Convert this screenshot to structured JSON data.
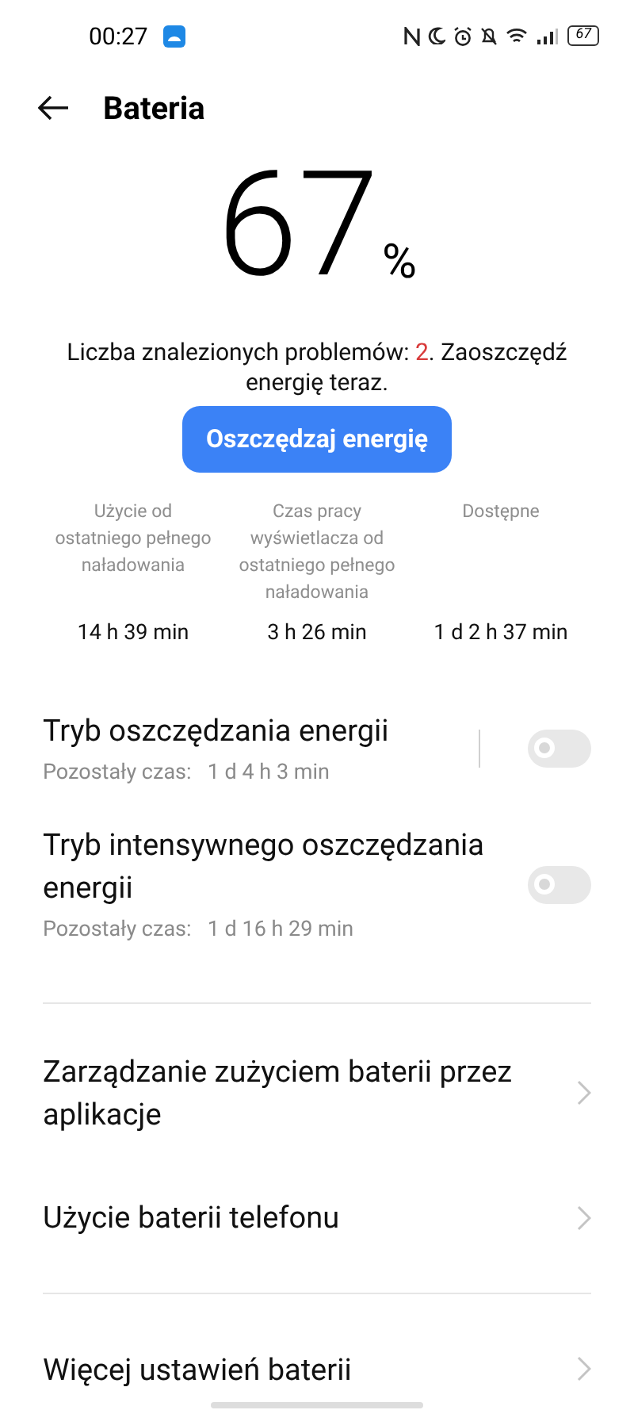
{
  "status_bar": {
    "time": "00:27",
    "battery": "67"
  },
  "header": {
    "title": "Bateria"
  },
  "level": {
    "value": "67",
    "unit": "%"
  },
  "problems": {
    "prefix": "Liczba znalezionych problemów: ",
    "count": "2",
    "suffix": ". Zaoszczędź energię teraz."
  },
  "action_button": "Oszczędzaj energię",
  "stats": [
    {
      "label": "Użycie od ostatniego pełnego naładowania",
      "value": "14 h 39 min"
    },
    {
      "label": "Czas pracy wyświetlacza od ostatniego pełnego naładowania",
      "value": "3 h 26 min"
    },
    {
      "label": "Dostępne",
      "value": "1 d 2 h 37 min"
    }
  ],
  "toggles": [
    {
      "title": "Tryb oszczędzania energii",
      "caption": "Pozostały czas:",
      "time": "1 d 4 h 3 min",
      "on": false,
      "divider": true
    },
    {
      "title": "Tryb intensywnego oszczędzania energii",
      "caption": "Pozostały czas:",
      "time": "1 d 16 h 29 min",
      "on": false,
      "divider": false
    }
  ],
  "links": [
    {
      "label": "Zarządzanie zużyciem baterii przez aplikacje"
    },
    {
      "label": "Użycie baterii telefonu"
    }
  ],
  "more_links": [
    {
      "label": "Więcej ustawień baterii"
    }
  ]
}
